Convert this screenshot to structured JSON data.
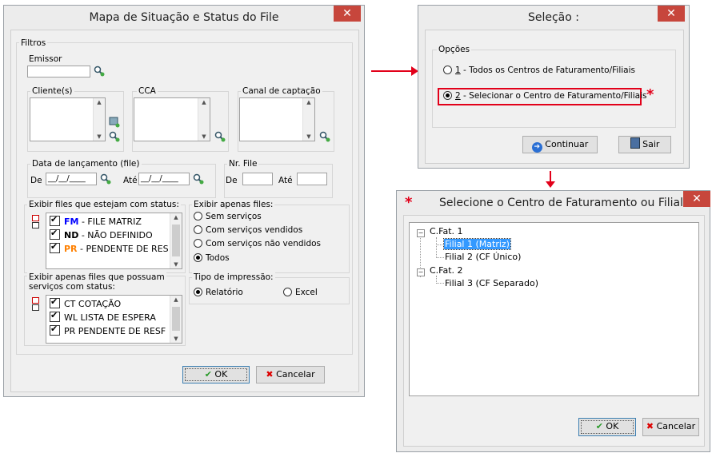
{
  "win1": {
    "title": "Mapa de Situação e Status do File",
    "close": "✕",
    "filtros": "Filtros",
    "emissor": "Emissor",
    "clientes": "Cliente(s)",
    "cca": "CCA",
    "canal": "Canal de captação",
    "data_lanc": "Data de lançamento (file)",
    "de": "De",
    "ate": "Até",
    "date_value": "__/__/____",
    "nr_file": "Nr. File",
    "status_group": "Exibir files que estejam com status:",
    "status_items": [
      {
        "code": "FM",
        "text": " - FILE MATRIZ",
        "color": "#0000ff"
      },
      {
        "code": "ND",
        "text": " - NÃO DEFINIDO",
        "color": "#000000"
      },
      {
        "code": "PR",
        "text": " - PENDENTE DE RES",
        "color": "#ff8000"
      }
    ],
    "exibir_apenas": "Exibir apenas files:",
    "radio_files": [
      "Sem serviços",
      "Com serviços vendidos",
      "Com serviços não vendidos",
      "Todos"
    ],
    "servicos_group_line1": "Exibir apenas files que possuam",
    "servicos_group_line2": "serviços com status:",
    "servicos_items": [
      "CT  COTAÇÃO",
      "WL LISTA DE ESPERA",
      "PR  PENDENTE DE RESF"
    ],
    "tipo_impressao": "Tipo de impressão:",
    "relatorio": "Relatório",
    "excel": "Excel",
    "ok": "OK",
    "cancelar": "Cancelar"
  },
  "win2": {
    "title": "Seleção :",
    "close": "✕",
    "opcoes": "Opções",
    "opt1_key": "1",
    "opt1": " - Todos os Centros de Faturamento/Filiais",
    "opt2_key": "2",
    "opt2": " - Selecionar o Centro de Faturamento/Filiais",
    "continuar": "Continuar",
    "sair": "Sair"
  },
  "win3": {
    "title": "Selecione o Centro de Faturamento ou Filial",
    "close": "✕",
    "tree": [
      {
        "label": "C.Fat. 1",
        "children": [
          "Filial 1 (Matriz)",
          "Filial 2 (CF Único)"
        ]
      },
      {
        "label": "C.Fat. 2",
        "children": [
          "Filial 3 (CF Separado)"
        ]
      }
    ],
    "ok": "OK",
    "cancelar": "Cancelar"
  },
  "annotations": {
    "asterisk": "*",
    "accent": "#e2001a"
  }
}
